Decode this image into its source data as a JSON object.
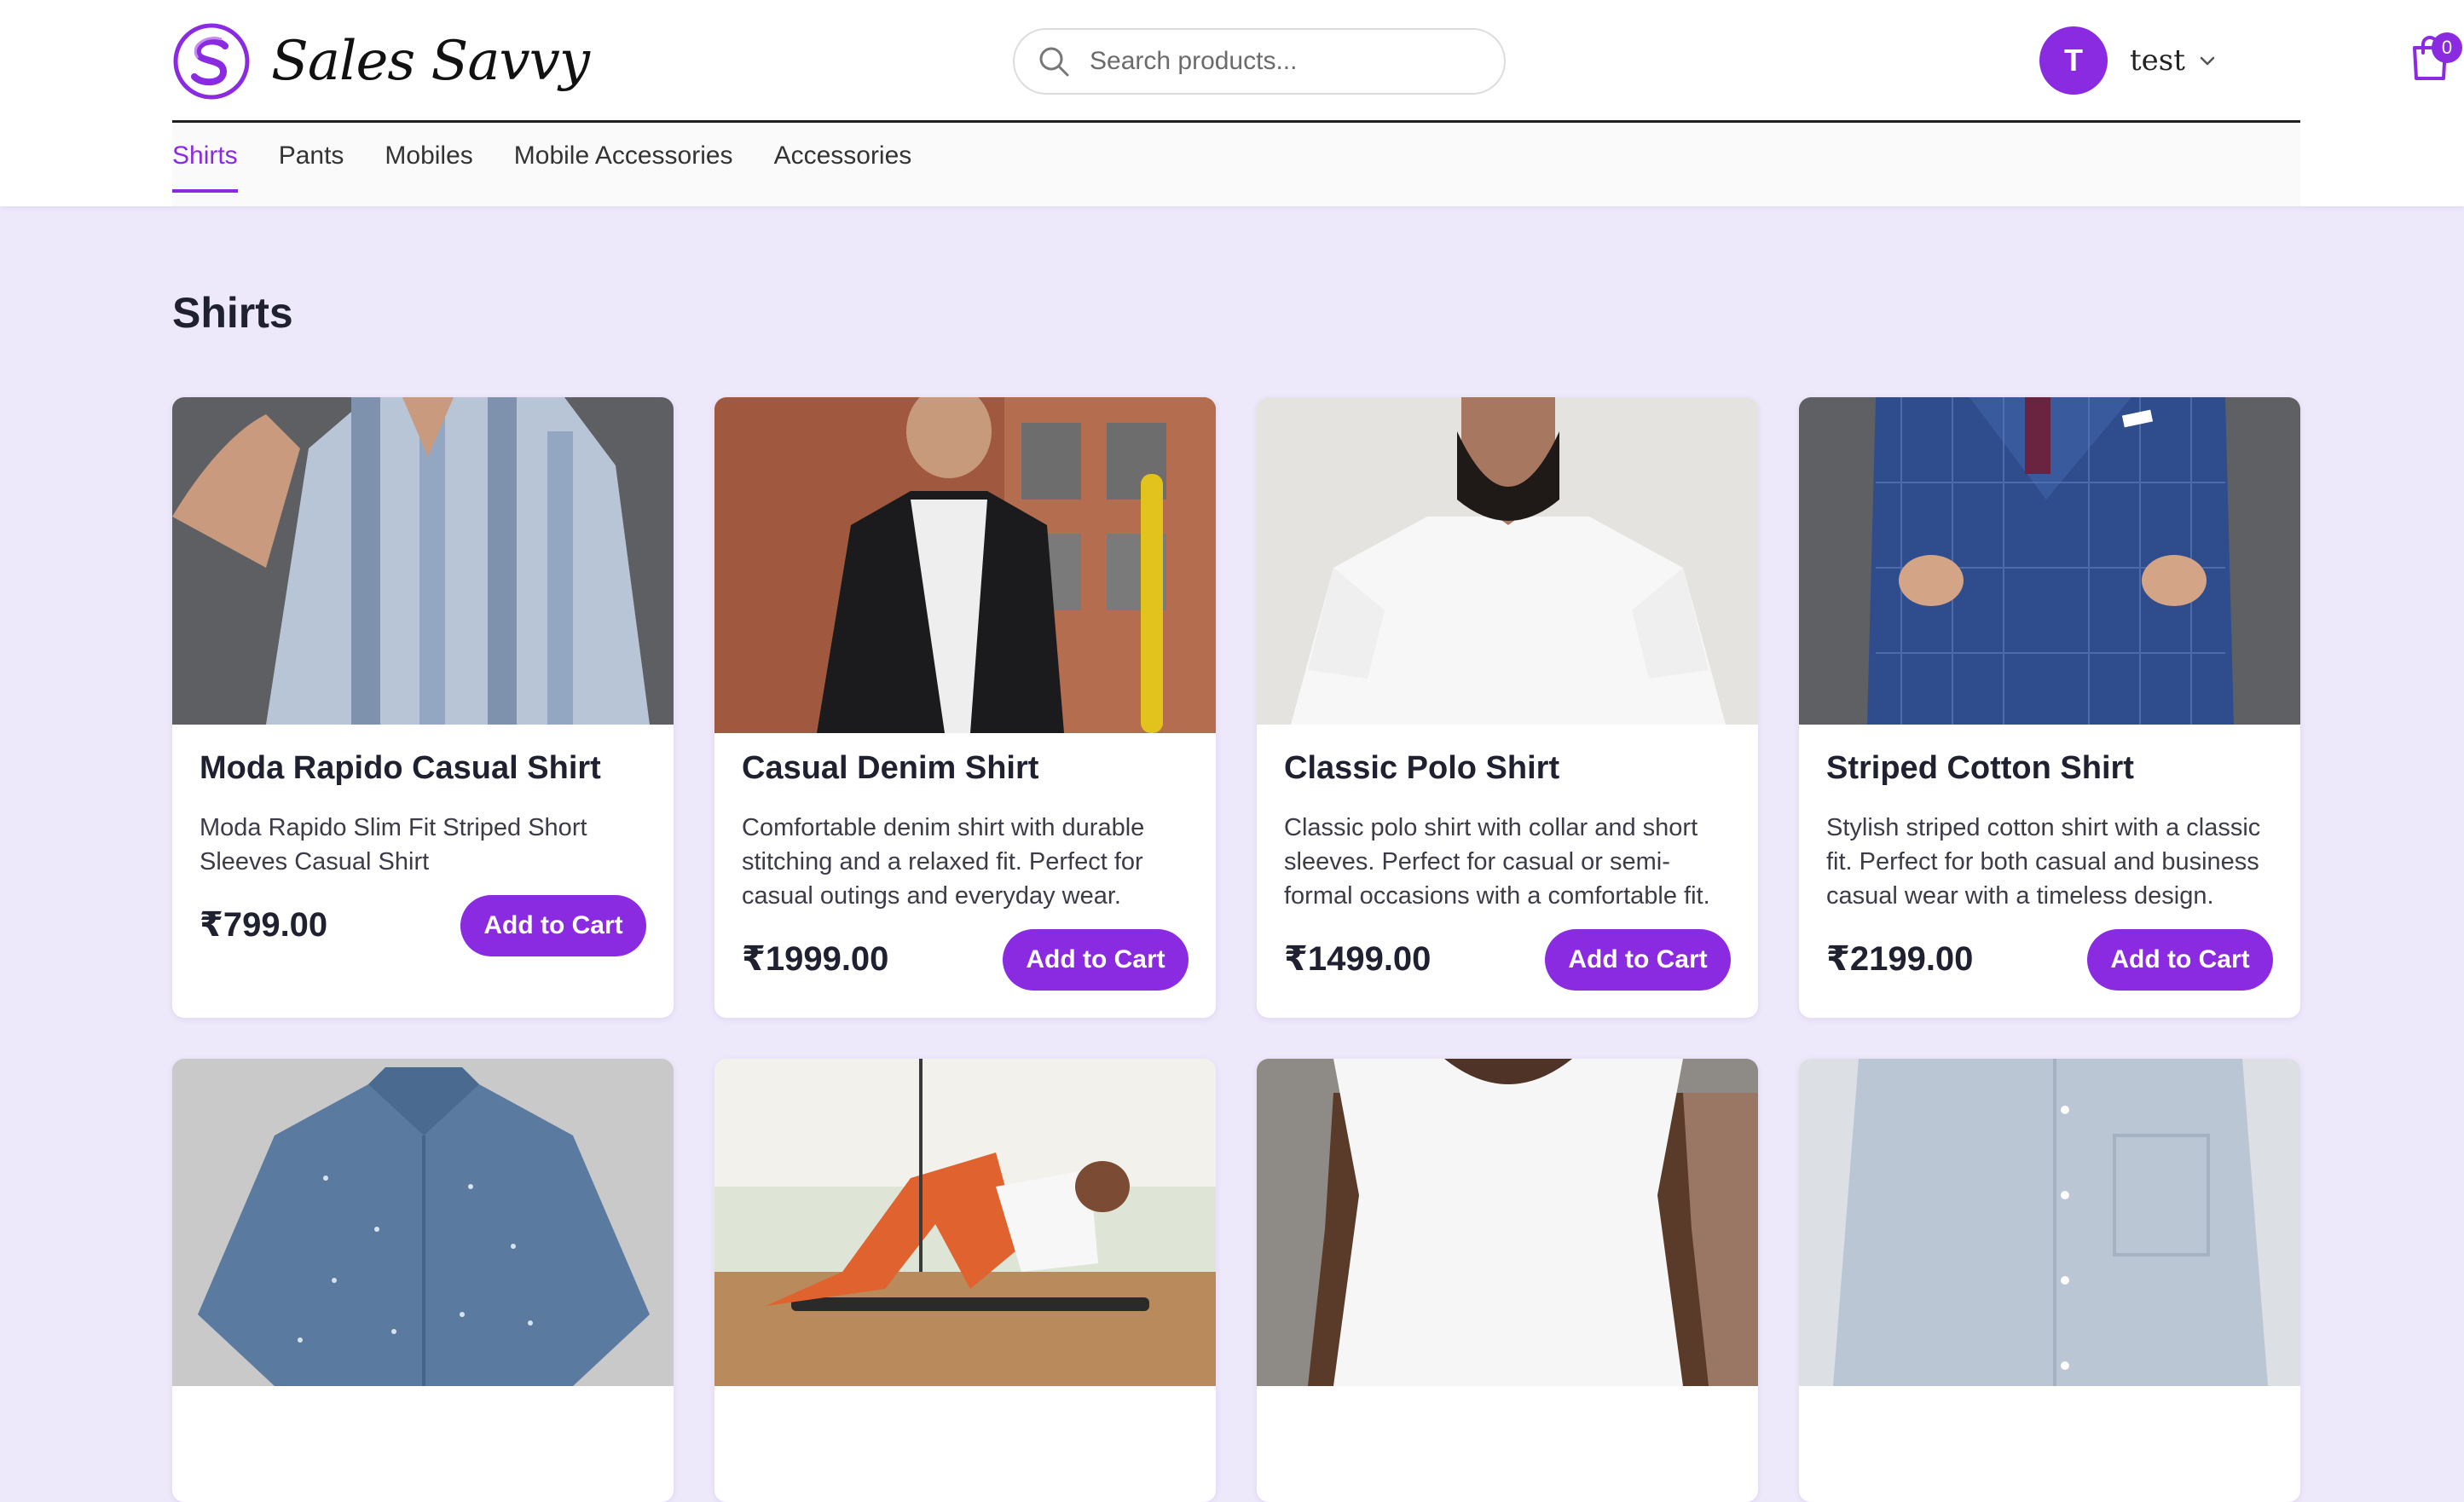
{
  "app": {
    "logo_text": "Sales Savvy",
    "search_placeholder": "Search products...",
    "user_initial": "T",
    "username": "test",
    "cart_count": "0"
  },
  "nav": {
    "items": [
      {
        "label": "Shirts",
        "active": true
      },
      {
        "label": "Pants"
      },
      {
        "label": "Mobiles"
      },
      {
        "label": "Mobile Accessories"
      },
      {
        "label": "Accessories"
      }
    ]
  },
  "main": {
    "title": "Shirts",
    "products": [
      {
        "name": "Moda Rapido Casual Shirt",
        "description": "Moda Rapido Slim Fit Striped Short Sleeves Casual Shirt",
        "price": "₹799.00",
        "button": "Add to Cart"
      },
      {
        "name": "Casual Denim Shirt",
        "description": "Comfortable denim shirt with durable stitching and a relaxed fit. Perfect for casual outings and everyday wear.",
        "price": "₹1999.00",
        "button": "Add to Cart"
      },
      {
        "name": "Classic Polo Shirt",
        "description": "Classic polo shirt with collar and short sleeves. Perfect for casual or semi-formal occasions with a comfortable fit.",
        "price": "₹1499.00",
        "button": "Add to Cart"
      },
      {
        "name": "Striped Cotton Shirt",
        "description": "Stylish striped cotton shirt with a classic fit. Perfect for both casual and business casual wear with a timeless design.",
        "price": "₹2199.00",
        "button": "Add to Cart"
      }
    ]
  },
  "colors": {
    "accent": "#8a2be2",
    "page_bg": "#eee8fb"
  },
  "icons": [
    "logo-icon",
    "search-icon",
    "chevron-down-icon",
    "cart-icon"
  ]
}
